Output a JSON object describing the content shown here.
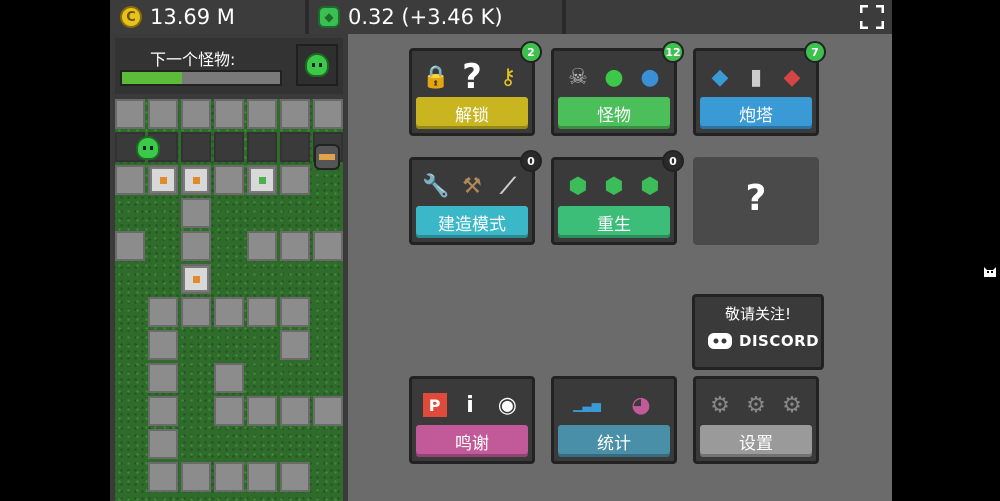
{
  "resources": {
    "coins": "13.69 M",
    "coin_icon": "coin-icon",
    "gems": "0.32 (+3.46 K)",
    "gem_icon": "gem-icon"
  },
  "next_monster": {
    "label": "下一个怪物:",
    "progress": 0.38,
    "icon": "green-slime-icon"
  },
  "menu": [
    {
      "label": "解锁",
      "badge": "2",
      "icons": [
        "lock-icon",
        "question-icon",
        "key-icon"
      ],
      "color": "#c9b520"
    },
    {
      "label": "怪物",
      "badge": "12",
      "icons": [
        "skull-icon",
        "slime-icon",
        "blue-monster-icon"
      ],
      "color": "#4bbf5a"
    },
    {
      "label": "炮塔",
      "badge": "7",
      "icons": [
        "blue-turret-icon",
        "gray-turret-icon",
        "red-turret-icon"
      ],
      "color": "#3a9ad6"
    },
    {
      "label": "建造模式",
      "badge": "0",
      "icons": [
        "wrench-icon",
        "hammer-icon",
        "saw-icon"
      ],
      "color": "#3ab8c8"
    },
    {
      "label": "重生",
      "badge": "0",
      "icons": [
        "gem-icon",
        "gem-icon",
        "gem-icon"
      ],
      "color": "#3cbd78"
    },
    {
      "label": "?",
      "locked": true
    },
    {
      "label": "鸣谢",
      "icons": [
        "patreon-icon",
        "info-icon",
        "discord-icon"
      ],
      "color": "#c25a9a"
    },
    {
      "label": "统计",
      "icons": [
        "bar-chart-icon",
        "pie-chart-icon"
      ],
      "color": "#4a8fa8"
    },
    {
      "label": "设置",
      "icons": [
        "gear-icon",
        "gear-icon",
        "gear-icon"
      ],
      "color": "#9a9a9a"
    }
  ],
  "follow": {
    "label": "敬请关注!",
    "brand": "DISCORD"
  },
  "colors": {
    "badge_green": "#3ec04e",
    "badge_dark": "#2a2a2a"
  }
}
